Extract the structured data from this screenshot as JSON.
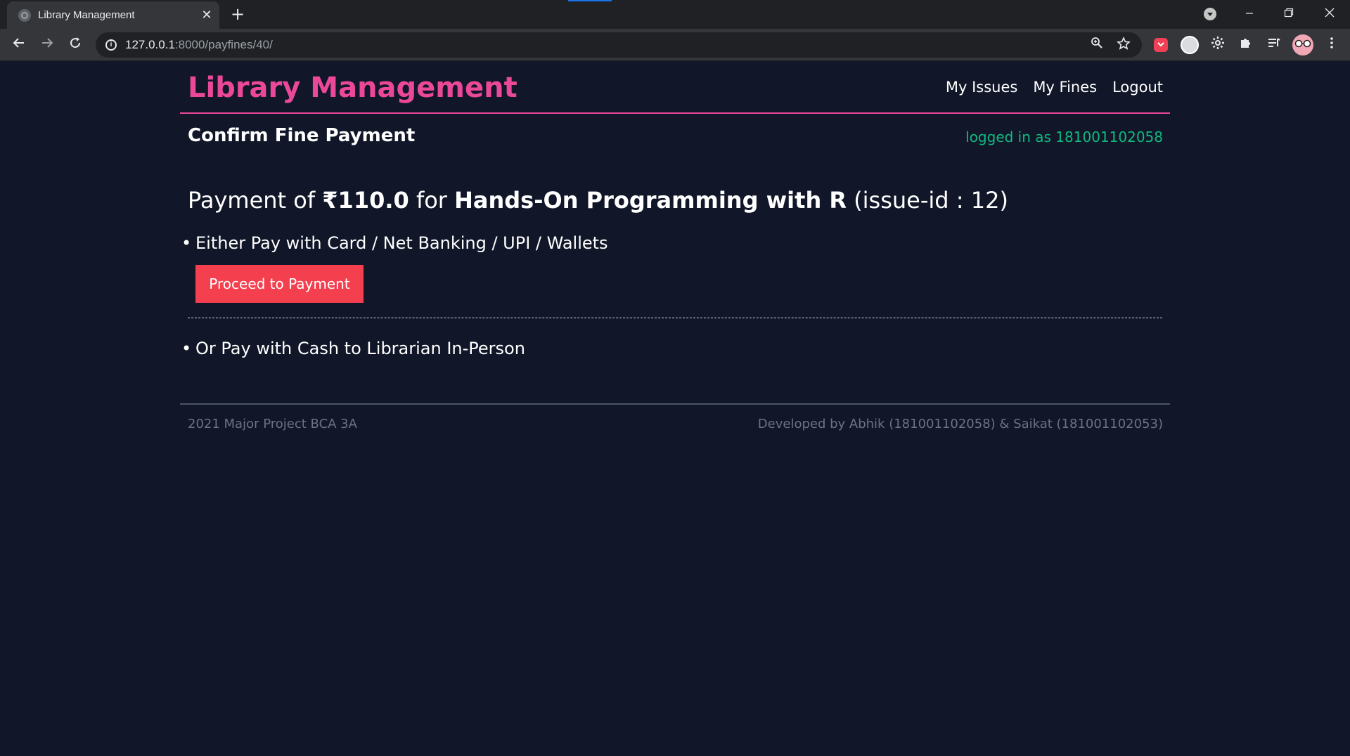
{
  "browser": {
    "tab_title": "Library Management",
    "tab_close": "✕",
    "new_tab": "+",
    "url_host": "127.0.0.1",
    "url_rest": ":8000/payfines/40/",
    "info_icon_glyph": "i"
  },
  "header": {
    "brand": "Library Management",
    "nav": {
      "my_issues": "My Issues",
      "my_fines": "My Fines",
      "logout": "Logout"
    }
  },
  "page": {
    "title": "Confirm Fine Payment",
    "logged_in": "logged in as 181001102058",
    "payment": {
      "prefix": "Payment of ",
      "amount": "₹110.0",
      "middle": " for ",
      "book": "Hands-On Programming with R",
      "issue": " (issue-id : 12)"
    },
    "option_card": "Either Pay with Card / Net Banking / UPI / Wallets",
    "pay_button": "Proceed to Payment",
    "option_cash": "Or Pay with Cash to Librarian In-Person"
  },
  "footer": {
    "left": "2021 Major Project BCA 3A",
    "right": "Developed by Abhik (181001102058) & Saikat (181001102053)"
  },
  "colors": {
    "background": "#111729",
    "brand": "#ec4899",
    "logged_in": "#10b981",
    "button": "#f43f4f"
  }
}
